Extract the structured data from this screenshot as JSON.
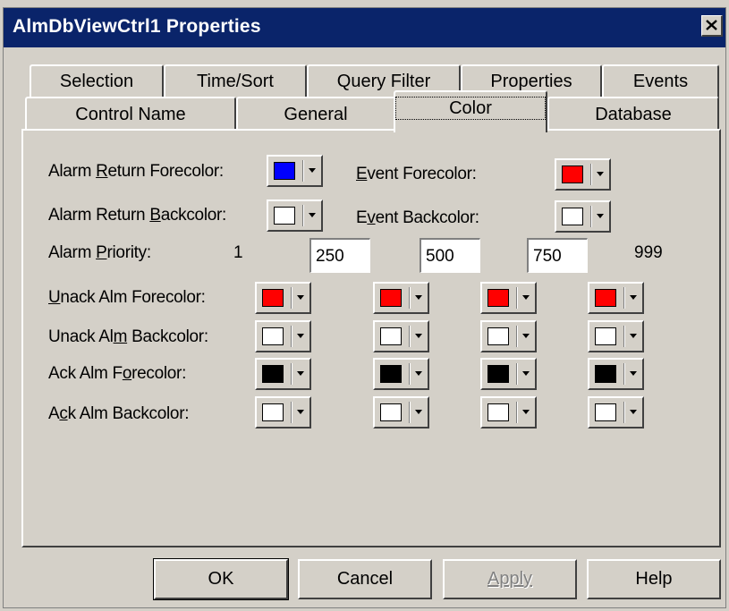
{
  "window": {
    "title": "AlmDbViewCtrl1 Properties"
  },
  "tabs_row1": [
    {
      "label": "Selection"
    },
    {
      "label": "Time/Sort"
    },
    {
      "label": "Query Filter"
    },
    {
      "label": "Properties"
    },
    {
      "label": "Events"
    }
  ],
  "tabs_row2": [
    {
      "label": "Control Name"
    },
    {
      "label": "General"
    },
    {
      "label": "Color",
      "active": true
    },
    {
      "label": "Database"
    }
  ],
  "labels": {
    "alarm_return_fore": {
      "pre": "Alarm ",
      "u": "R",
      "post": "eturn Forecolor:"
    },
    "alarm_return_back": {
      "pre": "Alarm Return ",
      "u": "B",
      "post": "ackcolor:"
    },
    "event_fore": {
      "pre": "",
      "u": "E",
      "post": "vent Forecolor:"
    },
    "event_back": {
      "pre": "E",
      "u": "v",
      "post": "ent Backcolor:"
    },
    "alarm_priority": {
      "pre": "Alarm ",
      "u": "P",
      "post": "riority:"
    },
    "unack_fore": {
      "pre": "",
      "u": "U",
      "post": "nack Alm Forecolor:"
    },
    "unack_back": {
      "pre": "Unack Al",
      "u": "m",
      "post": " Backcolor:"
    },
    "ack_fore": {
      "pre": "Ack Alm F",
      "u": "o",
      "post": "recolor:"
    },
    "ack_back": {
      "pre": "A",
      "u": "c",
      "post": "k Alm Backcolor:"
    }
  },
  "priority": {
    "min": "1",
    "field1": "250",
    "field2": "500",
    "field3": "750",
    "max": "999"
  },
  "colors": {
    "alarm_return_fore": "#0000ff",
    "alarm_return_back": "#ffffff",
    "event_fore": "#ff0000",
    "event_back": "#ffffff",
    "unack_fore": [
      "#ff0000",
      "#ff0000",
      "#ff0000",
      "#ff0000"
    ],
    "unack_back": [
      "#ffffff",
      "#ffffff",
      "#ffffff",
      "#ffffff"
    ],
    "ack_fore": [
      "#000000",
      "#000000",
      "#000000",
      "#000000"
    ],
    "ack_back": [
      "#ffffff",
      "#ffffff",
      "#ffffff",
      "#ffffff"
    ]
  },
  "buttons": {
    "ok": "OK",
    "cancel": "Cancel",
    "apply": "Apply",
    "help": "Help"
  },
  "icons": {
    "close": "close-icon",
    "dropdown": "chevron-down-icon"
  }
}
